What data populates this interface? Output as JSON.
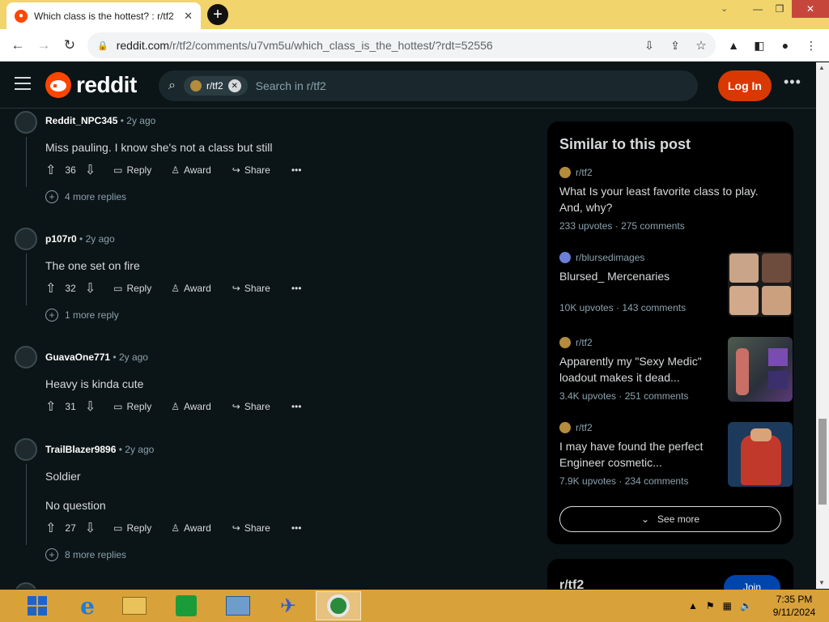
{
  "browser": {
    "tab_title": "Which class is the hottest? : r/tf2",
    "url_host": "reddit.com",
    "url_path": "/r/tf2/comments/u7vm5u/which_class_is_the_hottest/?rdt=52556"
  },
  "header": {
    "logo": "reddit",
    "search_chip": "r/tf2",
    "search_placeholder": "Search in r/tf2",
    "login": "Log In"
  },
  "comments": [
    {
      "user": "Reddit_NPC345",
      "time": "2y ago",
      "lines": [
        "Miss pauling. I know she's not a class but still"
      ],
      "votes": "36",
      "more_replies": "4 more replies"
    },
    {
      "user": "p107r0",
      "time": "2y ago",
      "lines": [
        "The one set on fire"
      ],
      "votes": "32",
      "more_replies": "1 more reply"
    },
    {
      "user": "GuavaOne771",
      "time": "2y ago",
      "lines": [
        "Heavy is kinda cute"
      ],
      "votes": "31",
      "more_replies": ""
    },
    {
      "user": "TrailBlazer9896",
      "time": "2y ago",
      "lines": [
        "Soldier",
        "No question"
      ],
      "votes": "27",
      "more_replies": "8 more replies"
    }
  ],
  "actions": {
    "reply": "Reply",
    "award": "Award",
    "share": "Share"
  },
  "sidebar": {
    "heading": "Similar to this post",
    "posts": [
      {
        "sub": "r/tf2",
        "title": "What Is your least favorite class to play. And, why?",
        "upvotes": "233 upvotes",
        "comments": "275 comments",
        "thumb": false
      },
      {
        "sub": "r/blursedimages",
        "title": "Blursed_ Mercenaries",
        "upvotes": "10K upvotes",
        "comments": "143 comments",
        "thumb": true
      },
      {
        "sub": "r/tf2",
        "title": "Apparently my \"Sexy Medic\" loadout makes it dead...",
        "upvotes": "3.4K upvotes",
        "comments": "251 comments",
        "thumb": true
      },
      {
        "sub": "r/tf2",
        "title": "I may have found the perfect Engineer cosmetic...",
        "upvotes": "7.9K upvotes",
        "comments": "234 comments",
        "thumb": true
      }
    ],
    "see_more": "See more",
    "community": "r/tf2",
    "join": "Join"
  },
  "taskbar": {
    "time": "7:35 PM",
    "date": "9/11/2024"
  }
}
